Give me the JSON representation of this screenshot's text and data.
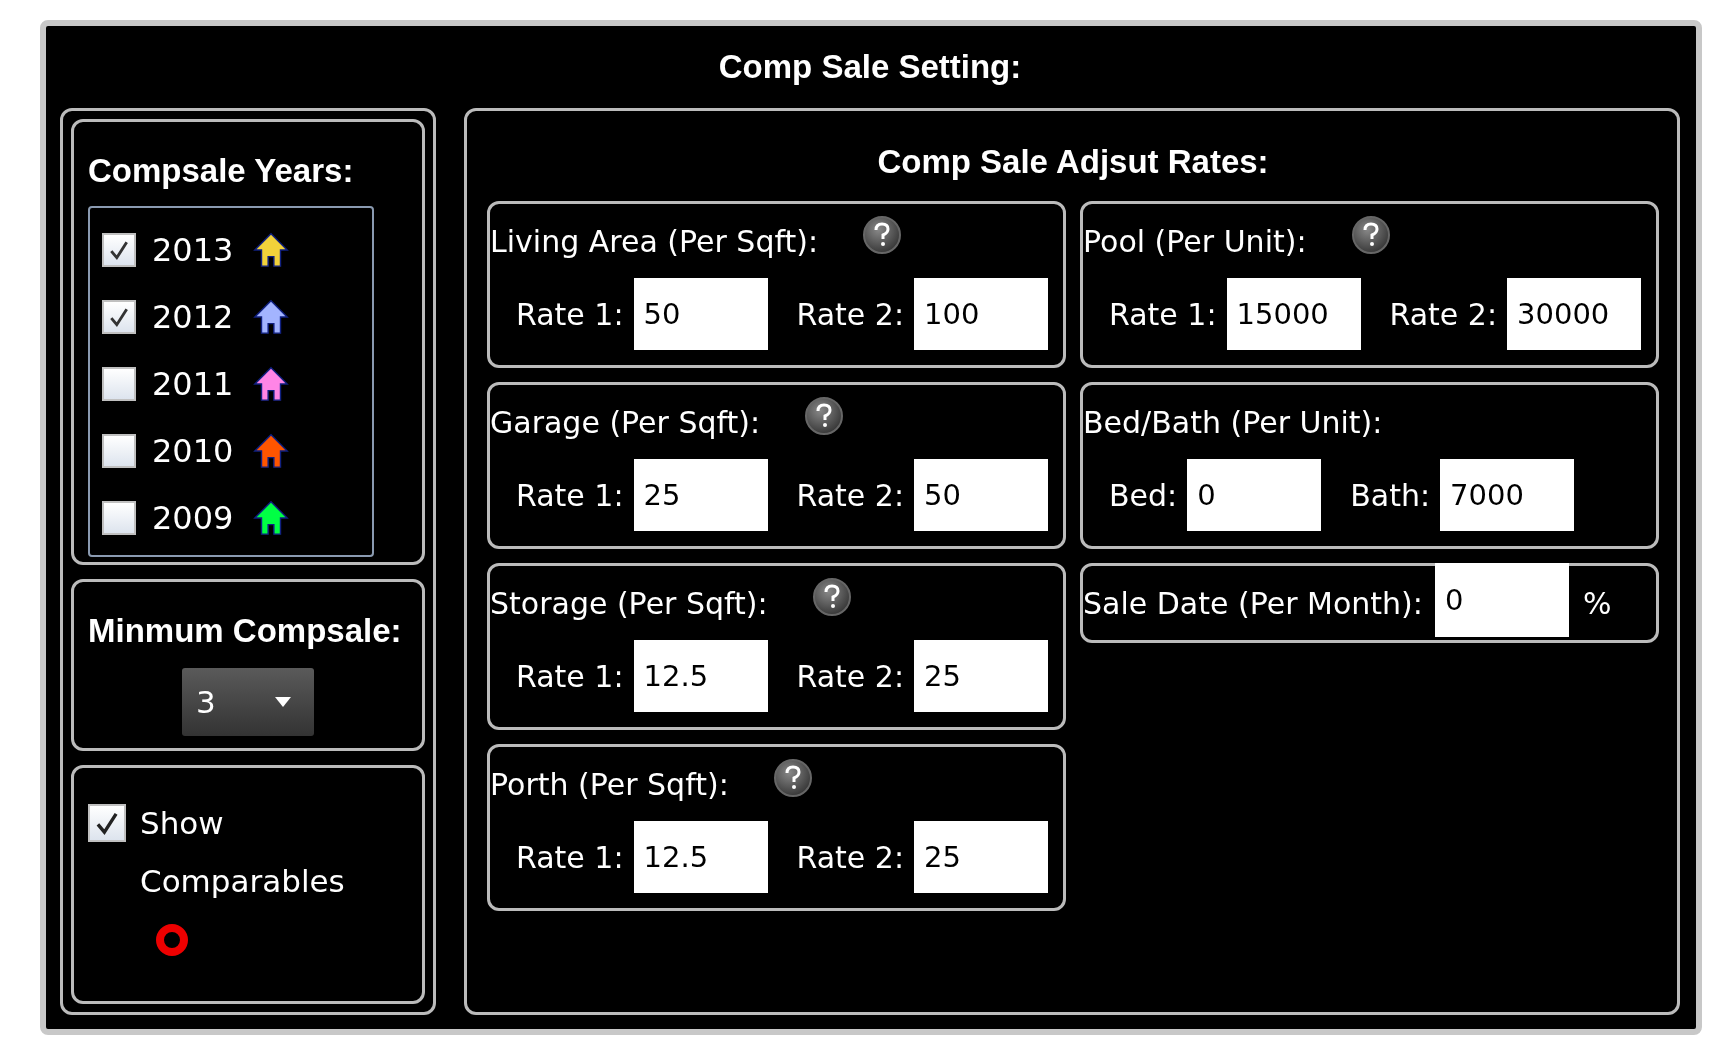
{
  "title": "Comp Sale Setting:",
  "years": {
    "title": "Compsale Years:",
    "items": [
      {
        "year": "2013",
        "checked": true,
        "color": "#f2d23a"
      },
      {
        "year": "2012",
        "checked": true,
        "color": "#a3b4ff"
      },
      {
        "year": "2011",
        "checked": false,
        "color": "#ff85e6"
      },
      {
        "year": "2010",
        "checked": false,
        "color": "#ff5500"
      },
      {
        "year": "2009",
        "checked": false,
        "color": "#00ff44"
      }
    ]
  },
  "minimum": {
    "title": "Minmum Compsale:",
    "value": "3"
  },
  "show": {
    "label": "Show Comparables",
    "checked": true
  },
  "rates": {
    "title": "Comp Sale Adjsut Rates:",
    "columns": [
      {
        "cards": [
          {
            "kind": "pair",
            "title": "Living Area (Per Sqft):",
            "help": true,
            "fields": [
              {
                "label": "Rate 1:",
                "value": "50"
              },
              {
                "label": "Rate 2:",
                "value": "100"
              }
            ]
          },
          {
            "kind": "pair",
            "title": "Garage (Per Sqft):",
            "help": true,
            "fields": [
              {
                "label": "Rate 1:",
                "value": "25"
              },
              {
                "label": "Rate 2:",
                "value": "50"
              }
            ]
          },
          {
            "kind": "pair",
            "title": "Storage (Per Sqft):",
            "help": true,
            "fields": [
              {
                "label": "Rate 1:",
                "value": "12.5"
              },
              {
                "label": "Rate 2:",
                "value": "25"
              }
            ]
          },
          {
            "kind": "pair",
            "title": "Porth (Per Sqft):",
            "help": true,
            "fields": [
              {
                "label": "Rate 1:",
                "value": "12.5"
              },
              {
                "label": "Rate 2:",
                "value": "25"
              }
            ]
          }
        ]
      },
      {
        "cards": [
          {
            "kind": "pair",
            "title": "Pool (Per Unit):",
            "help": true,
            "fields": [
              {
                "label": "Rate 1:",
                "value": "15000"
              },
              {
                "label": "Rate 2:",
                "value": "30000"
              }
            ]
          },
          {
            "kind": "pair",
            "title": "Bed/Bath (Per Unit):",
            "help": false,
            "fields": [
              {
                "label": "Bed:",
                "value": "0"
              },
              {
                "label": "Bath:",
                "value": "7000"
              }
            ]
          },
          {
            "kind": "inline",
            "title": "Sale Date (Per Month):",
            "fields": [
              {
                "value": "0"
              }
            ],
            "unit": "%"
          }
        ]
      }
    ]
  }
}
